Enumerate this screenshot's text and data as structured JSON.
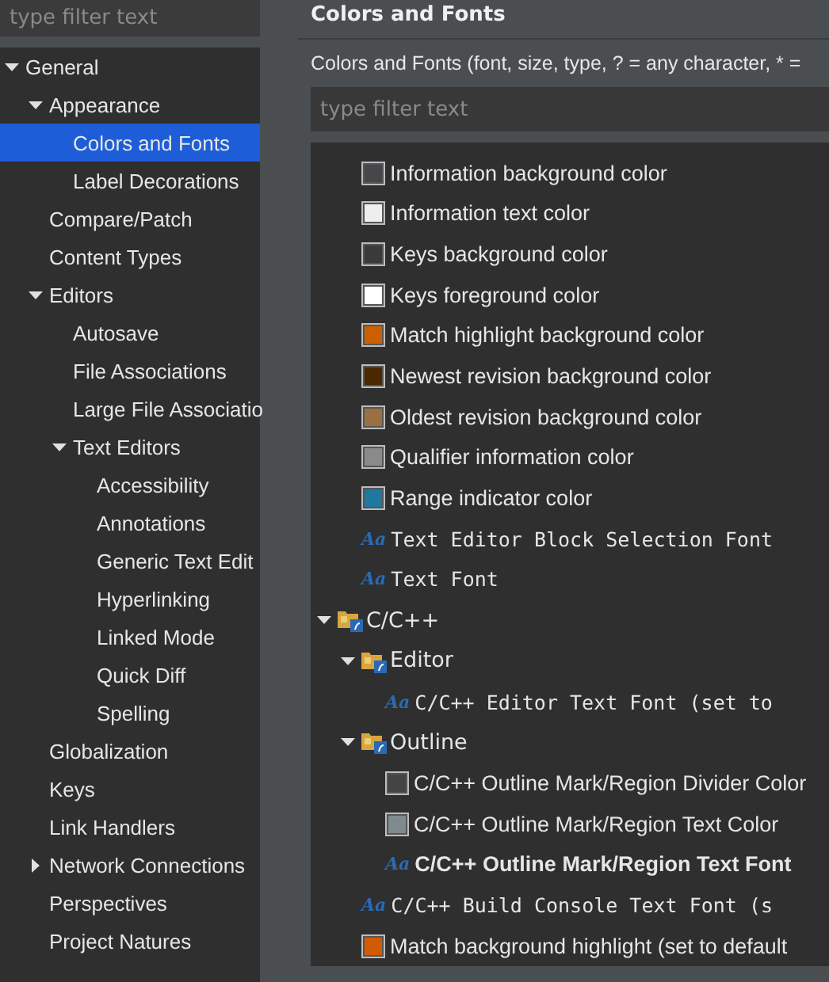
{
  "sidebar": {
    "filter": {
      "placeholder": "type filter text"
    },
    "items": [
      {
        "label": "General",
        "expanded": true,
        "selected": false,
        "children": [
          {
            "label": "Appearance",
            "expanded": true,
            "selected": false,
            "children": [
              {
                "label": "Colors and Fonts",
                "selected": true
              },
              {
                "label": "Label Decorations",
                "selected": false
              }
            ]
          },
          {
            "label": "Compare/Patch",
            "selected": false
          },
          {
            "label": "Content Types",
            "selected": false
          },
          {
            "label": "Editors",
            "expanded": true,
            "selected": false,
            "children": [
              {
                "label": "Autosave",
                "selected": false
              },
              {
                "label": "File Associations",
                "selected": false
              },
              {
                "label": "Large File Associatio",
                "selected": false
              },
              {
                "label": "Text Editors",
                "expanded": true,
                "selected": false,
                "children": [
                  {
                    "label": "Accessibility",
                    "selected": false
                  },
                  {
                    "label": "Annotations",
                    "selected": false
                  },
                  {
                    "label": "Generic Text Edit",
                    "selected": false
                  },
                  {
                    "label": "Hyperlinking",
                    "selected": false
                  },
                  {
                    "label": "Linked Mode",
                    "selected": false
                  },
                  {
                    "label": "Quick Diff",
                    "selected": false
                  },
                  {
                    "label": "Spelling",
                    "selected": false
                  }
                ]
              }
            ]
          },
          {
            "label": "Globalization",
            "selected": false
          },
          {
            "label": "Keys",
            "selected": false
          },
          {
            "label": "Link Handlers",
            "selected": false
          },
          {
            "label": "Network Connections",
            "expanded": false,
            "selected": false
          },
          {
            "label": "Perspectives",
            "selected": false
          },
          {
            "label": "Project Natures",
            "selected": false
          }
        ]
      }
    ]
  },
  "page": {
    "title": "Colors and Fonts",
    "description": "Colors and Fonts (font, size, type, ? = any character, * =",
    "filter": {
      "placeholder": "type filter text"
    },
    "tree": [
      {
        "kind": "color",
        "label": "Information background color",
        "color": "#45474a"
      },
      {
        "kind": "color",
        "label": "Information text color",
        "color": "#eeeeee"
      },
      {
        "kind": "color",
        "label": "Keys background color",
        "color": "#3a3a3a"
      },
      {
        "kind": "color",
        "label": "Keys foreground color",
        "color": "#ffffff"
      },
      {
        "kind": "color",
        "label": "Match highlight background color",
        "color": "#cc6000"
      },
      {
        "kind": "color",
        "label": "Newest revision background color",
        "color": "#4a2800"
      },
      {
        "kind": "color",
        "label": "Oldest revision background color",
        "color": "#9a7040"
      },
      {
        "kind": "color",
        "label": "Qualifier information color",
        "color": "#8a8a8a"
      },
      {
        "kind": "color",
        "label": "Range indicator color",
        "color": "#1f78a0"
      },
      {
        "kind": "font",
        "icon": "Aa",
        "label": "Text Editor Block Selection Font",
        "bold": false
      },
      {
        "kind": "font",
        "icon": "Aa",
        "label": "Text Font",
        "bold": false
      },
      {
        "kind": "category",
        "label": "C/C++",
        "expanded": true,
        "children": [
          {
            "kind": "category",
            "label": "Editor",
            "expanded": true,
            "children": [
              {
                "kind": "font",
                "icon": "Aa",
                "label": "C/C++ Editor Text Font (set to",
                "bold": false
              }
            ]
          },
          {
            "kind": "category",
            "label": "Outline",
            "expanded": true,
            "children": [
              {
                "kind": "color",
                "label": "C/C++ Outline Mark/Region Divider Color",
                "color": "#444444"
              },
              {
                "kind": "color",
                "label": "C/C++ Outline Mark/Region Text Color",
                "color": "#7f8a90"
              },
              {
                "kind": "font",
                "icon": "Aa",
                "label": "C/C++ Outline Mark/Region Text Font",
                "bold": true
              }
            ]
          },
          {
            "kind": "font",
            "icon": "Aa",
            "label": "C/C++ Build Console Text Font (s",
            "bold": false
          }
        ]
      },
      {
        "kind": "color",
        "label": "Match background highlight (set to default",
        "color": "#d25a00"
      }
    ]
  }
}
